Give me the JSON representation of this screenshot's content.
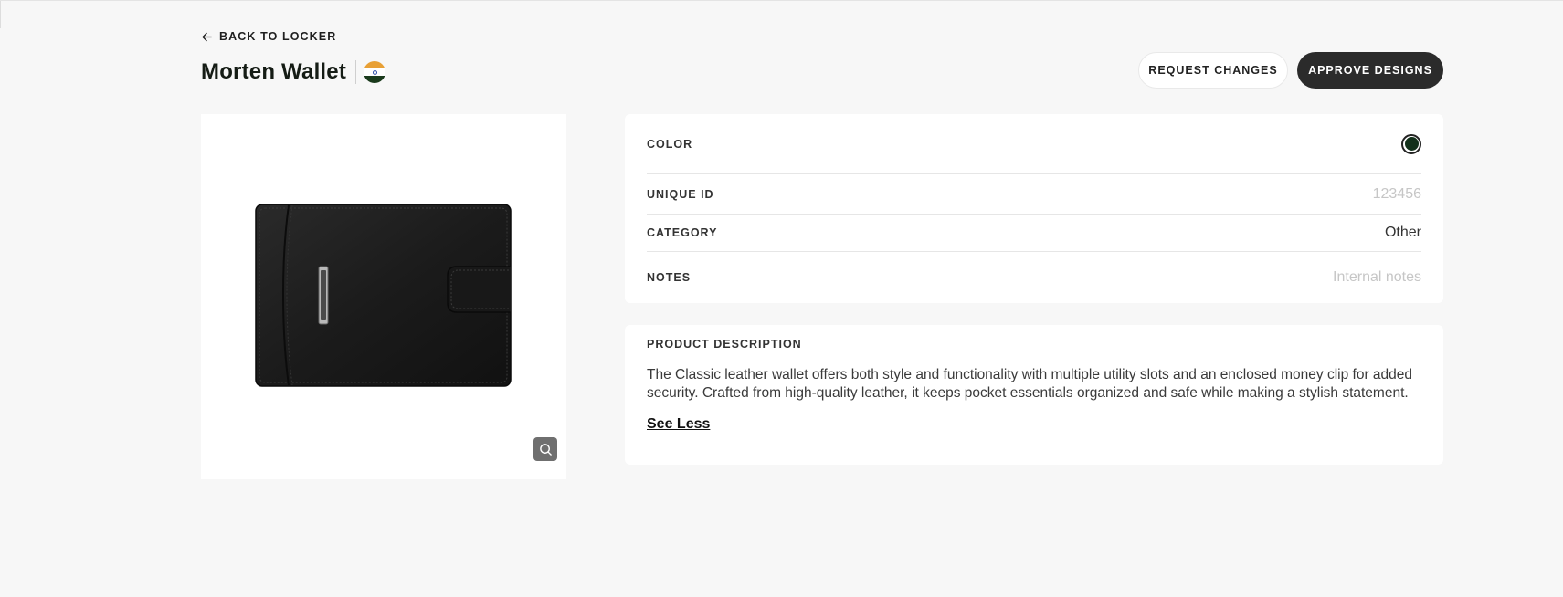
{
  "header": {
    "back_label": "BACK TO LOCKER",
    "title": "Morten Wallet",
    "request_label": "REQUEST CHANGES",
    "approve_label": "APPROVE DESIGNS"
  },
  "details": {
    "color_label": "COLOR",
    "color_value": "#12301a",
    "unique_id_label": "UNIQUE ID",
    "unique_id_placeholder": "123456",
    "category_label": "CATEGORY",
    "category_value": "Other",
    "notes_label": "NOTES",
    "notes_placeholder": "Internal notes"
  },
  "description": {
    "heading": "PRODUCT DESCRIPTION",
    "text": "The Classic leather wallet offers both style and functionality with multiple utility slots and an enclosed money clip for added security. Crafted from high-quality leather, it keeps pocket essentials organized and safe while making a stylish statement.",
    "toggle_label": "See Less"
  },
  "icons": {
    "back": "arrow-left-icon",
    "flag": "india-flag-icon",
    "zoom": "search-icon"
  },
  "colors": {
    "approve_bg": "#2b2b2b",
    "page_bg": "#f7f7f7"
  }
}
